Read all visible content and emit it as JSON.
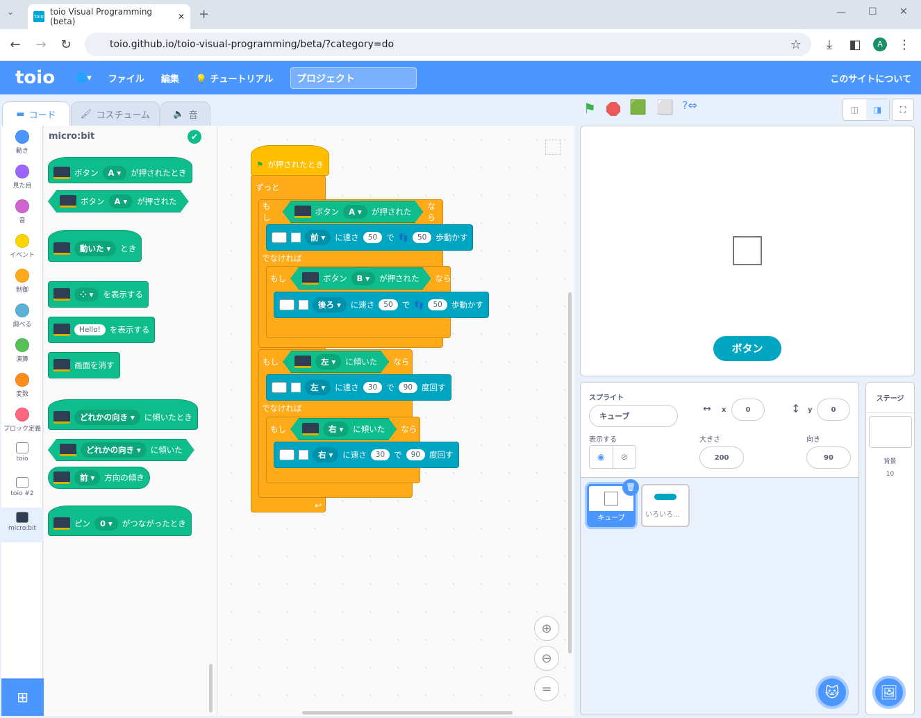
{
  "browser": {
    "tab_title": "toio Visual Programming (beta)",
    "url": "toio.github.io/toio-visual-programming/beta/?category=do",
    "profile": "A",
    "favicon": "toio"
  },
  "menu": {
    "logo": "toio",
    "globe": "🌐▾",
    "file": "ファイル",
    "edit": "編集",
    "tutorial": "チュートリアル",
    "project": "プロジェクト",
    "about": "このサイトについて"
  },
  "tabs": {
    "code": "コード",
    "costume": "コスチューム",
    "sound": "音"
  },
  "categories": [
    {
      "label": "動き",
      "color": "#4C97FF"
    },
    {
      "label": "見た目",
      "color": "#9966FF"
    },
    {
      "label": "音",
      "color": "#CF63CF"
    },
    {
      "label": "イベント",
      "color": "#FFD500"
    },
    {
      "label": "制御",
      "color": "#FFAB19"
    },
    {
      "label": "調べる",
      "color": "#5CB1D6"
    },
    {
      "label": "演算",
      "color": "#59C059"
    },
    {
      "label": "変数",
      "color": "#FF8C1A"
    },
    {
      "label": "ブロック定義",
      "color": "#FF6680"
    },
    {
      "label": "toio",
      "color": ""
    },
    {
      "label": "toio #2",
      "color": ""
    },
    {
      "label": "micro:bit",
      "color": ""
    }
  ],
  "palette": {
    "title": "micro:bit",
    "b1": {
      "a": "ボタン",
      "v": "A",
      "b": "が押されたとき"
    },
    "b2": {
      "a": "ボタン",
      "v": "A",
      "b": "が押された"
    },
    "b3": {
      "v": "動いた",
      "b": "とき"
    },
    "b4": {
      "b": "を表示する"
    },
    "b5": {
      "v": "Hello!",
      "b": "を表示する"
    },
    "b6": {
      "b": "画面を消す"
    },
    "b7": {
      "v": "どれかの向き",
      "b": "に傾いたとき"
    },
    "b8": {
      "v": "どれかの向き",
      "b": "に傾いた"
    },
    "b9": {
      "v": "前",
      "b": "方向の傾き"
    },
    "b10": {
      "a": "ピン",
      "v": "0",
      "b": "がつながったとき"
    }
  },
  "script": {
    "hat": "が押されたとき",
    "forever": "ずっと",
    "if": "もし",
    "then": "なら",
    "else": "でなければ",
    "if1": {
      "a": "ボタン",
      "v": "A",
      "b": "が押された"
    },
    "m1": {
      "dir": "前",
      "speed_l": "に速さ",
      "speed": "50",
      "de": "で",
      "steps": "50",
      "end": "歩動かす"
    },
    "if2": {
      "a": "ボタン",
      "v": "B",
      "b": "が押された"
    },
    "m2": {
      "dir": "後ろ",
      "speed_l": "に速さ",
      "speed": "50",
      "de": "で",
      "steps": "50",
      "end": "歩動かす"
    },
    "if3": {
      "v": "左",
      "b": "に傾いた"
    },
    "r1": {
      "dir": "左",
      "speed_l": "に速さ",
      "speed": "30",
      "de": "で",
      "deg": "90",
      "end": "度回す"
    },
    "if4": {
      "v": "右",
      "b": "に傾いた"
    },
    "r2": {
      "dir": "右",
      "speed_l": "に速さ",
      "speed": "30",
      "de": "で",
      "deg": "90",
      "end": "度回す"
    }
  },
  "stage": {
    "button": "ボタン"
  },
  "sprite": {
    "label": "スプライト",
    "name": "キューブ",
    "x_label": "x",
    "x": "0",
    "y_label": "y",
    "y": "0",
    "show_label": "表示する",
    "size_label": "大きさ",
    "size": "200",
    "dir_label": "向き",
    "dir": "90",
    "items": [
      {
        "name": "キューブ",
        "selected": true
      },
      {
        "name": "いろいろ..."
      }
    ]
  },
  "stage_panel": {
    "title": "ステージ",
    "backdrop_label": "背景",
    "backdrop_count": "10"
  },
  "colors": {
    "menu": "#4C97FF",
    "control": "#FFAB19",
    "events": "#FFBF00",
    "microbit": "#0FBD8C",
    "toio": "#00A5C2"
  }
}
